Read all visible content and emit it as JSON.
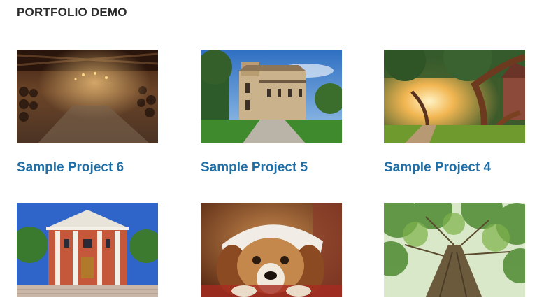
{
  "page": {
    "title": "PORTFOLIO DEMO"
  },
  "projects": [
    {
      "title": "Sample Project 6",
      "image": "wine-cellar-photo"
    },
    {
      "title": "Sample Project 5",
      "image": "victorian-mansion-photo"
    },
    {
      "title": "Sample Project 4",
      "image": "oak-trees-house-photo"
    },
    {
      "title": "",
      "image": "columned-building-photo"
    },
    {
      "title": "",
      "image": "beagle-dog-photo"
    },
    {
      "title": "",
      "image": "tree-looking-up-photo"
    }
  ]
}
